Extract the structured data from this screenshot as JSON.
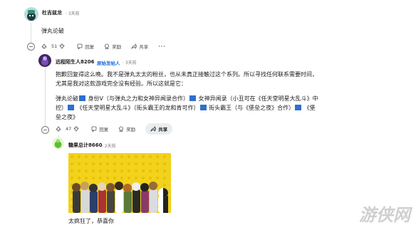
{
  "comment1": {
    "username": "杜吉兹龙",
    "time": "3天前",
    "text": "弹丸论破",
    "votes": "51"
  },
  "comment2": {
    "username": "远程陌生人8206",
    "op_badge": "原始发帖人",
    "time": "3天前",
    "text_line1": "抱歉回复得这么晚。我不是弹丸太太的粉丝，也从未真正接触过这个系列。所以寻找任何联系需要时间，",
    "text_line2": "尤其是我对这款游戏完全没有经验。所以这就是它：",
    "list_seg1": "弹丸论破",
    "list_seg2": "身份V（与弹丸之力和女神异闻录合作）",
    "list_seg3": "女神异闻录（小丑可在《任天堂明星大乱斗》中",
    "list_seg4": "控）",
    "list_seg5": "《任天堂明星大乱斗》（街头霸王的龙和肯可作）",
    "list_seg6": "街头霸王（与《堡垒之夜》合作）",
    "list_seg7": "《堡",
    "list_seg8": "垒之夜》",
    "votes": "47"
  },
  "comment3": {
    "username": "糖果总计8660",
    "time": "2天前",
    "caption": "太疯狂了，恭喜你"
  },
  "actions": {
    "reply": "回复",
    "award": "奖励",
    "share": "共享",
    "more": "···"
  },
  "watermark": "游侠网",
  "colors": {
    "op_badge": "#1a6dd8",
    "link_box": "#2f6fcf",
    "image_bg": "#f2d21c",
    "thread_line": "#d8dde1"
  }
}
